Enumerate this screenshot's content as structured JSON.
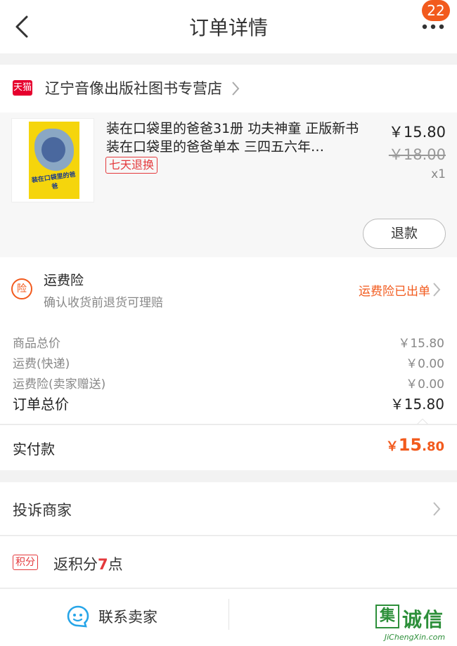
{
  "nav": {
    "title": "订单详情",
    "badge_count": "22"
  },
  "store": {
    "logo_text": "天猫",
    "name": "辽宁音像出版社图书专营店"
  },
  "item": {
    "cover_title": "装在口袋里的爸爸",
    "title": "装在口袋里的爸爸31册 功夫神童 正版新书 装在口袋里的爸爸单本 三四五六年…",
    "tag": "七天退换",
    "price": "￥15.80",
    "original_price": "￥18.00",
    "quantity": "x1",
    "refund_label": "退款"
  },
  "insurance": {
    "icon_text": "险",
    "title": "运费险",
    "subtitle": "确认收货前退货可理赔",
    "status": "运费险已出单"
  },
  "summary": {
    "rows": [
      {
        "label": "商品总价",
        "value": "￥15.80"
      },
      {
        "label": "运费(快递)",
        "value": "￥0.00"
      },
      {
        "label": "运费险(卖家赠送)",
        "value": "￥0.00"
      }
    ],
    "total_label": "订单总价",
    "total_value": "￥15.80"
  },
  "paid": {
    "label": "实付款",
    "currency": "￥",
    "integer": "15",
    "decimal": ".80"
  },
  "complain": {
    "label": "投诉商家"
  },
  "points": {
    "tag": "积分",
    "prefix": "返积分",
    "value": "7",
    "suffix": "点"
  },
  "bottom": {
    "contact_label": "联系卖家"
  },
  "watermark": {
    "box_char": "集",
    "word": "诚信",
    "url": "JiChengXin.com"
  },
  "colors": {
    "accent": "#f25a1d",
    "tmall_red": "#e6002e",
    "tag_red": "#e4393c"
  }
}
